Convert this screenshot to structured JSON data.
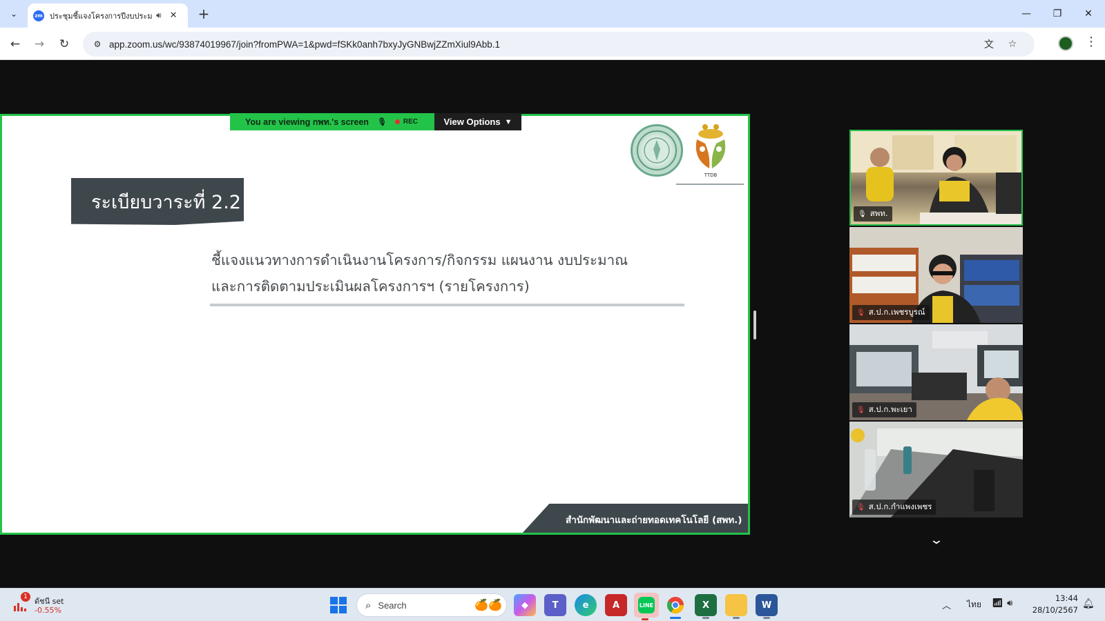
{
  "browser": {
    "tab_title": "ประชุมชี้แจงโครงการปีงบประมาณ",
    "tab_favicon_label": "zm",
    "url": "app.zoom.us/wc/93874019967/join?fromPWA=1&pwd=fSKk0anh7bxyJyGNBwjZZmXiul9Abb.1",
    "icons": [
      "tab-search-icon",
      "speaker-icon",
      "close-icon",
      "plus-icon",
      "minimize-icon",
      "restore-icon",
      "close-window-icon",
      "back-icon",
      "forward-icon",
      "reload-icon",
      "site-info-icon",
      "translate-icon",
      "star-icon",
      "profile-icon",
      "menu-icon"
    ]
  },
  "zoom": {
    "viewing_banner": "You are viewing กพท.'s screen",
    "rec_label": "REC",
    "view_options": "View Options",
    "accent_color": "#23c34a",
    "slide": {
      "title": "ระเบียบวาระที่ 2.2",
      "line1": "ชี้แจงแนวทางการดำเนินงานโครงการ/กิจกรรม แผนงาน งบประมาณ",
      "line2": "และการติดตามประเมินผลโครงการฯ (รายโครงการ)",
      "logo_text": "TTDB",
      "footer": "สำนักพัฒนาและถ่ายทอดเทคโนโลยี (สพท.)"
    },
    "participants": [
      {
        "name": "สพท.",
        "muted": false,
        "speaking": true
      },
      {
        "name": "ส.ป.ก.เพชรบูรณ์",
        "muted": true,
        "speaking": false
      },
      {
        "name": "ส.ป.ก.พะเยา",
        "muted": true,
        "speaking": false
      },
      {
        "name": "ส.ป.ก.กำแพงเพชร",
        "muted": true,
        "speaking": false
      }
    ]
  },
  "taskbar": {
    "widget_title": "ดัชนี set",
    "widget_value": "-0.55%",
    "widget_badge": "1",
    "search_label": "Search",
    "language": "ไทย",
    "time": "13:44",
    "date": "28/10/2567",
    "apps": [
      "copilot-icon",
      "teams-icon",
      "edge-icon",
      "acrobat-icon",
      "line-icon",
      "chrome-icon",
      "excel-icon",
      "file-explorer-icon",
      "word-icon"
    ]
  }
}
